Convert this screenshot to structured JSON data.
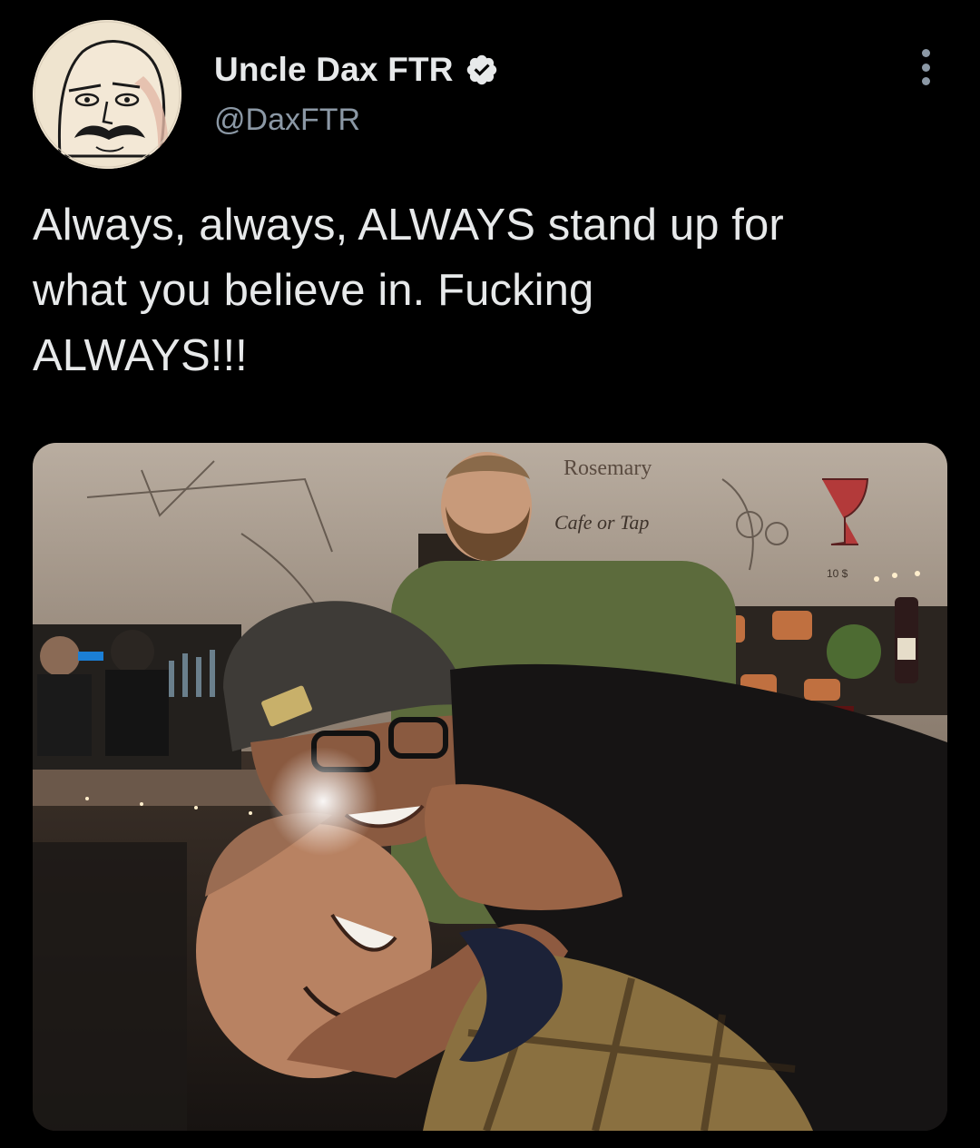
{
  "author": {
    "display_name": "Uncle Dax FTR",
    "handle": "@DaxFTR",
    "verified": true,
    "avatar_icon": "cartoon-bald-mustache-avatar",
    "verified_icon": "verified-badge-icon"
  },
  "tweet": {
    "text": "Always, always, ALWAYS stand up for\nwhat you believe in. Fucking\nALWAYS!!!"
  },
  "photo": {
    "wall_sign_text": "Rosemary",
    "wall_script_text": "Cafe or Tap",
    "price_tag": "10 $"
  },
  "colors": {
    "background": "#000000",
    "text_primary": "#e7e9ea",
    "text_secondary": "#8b98a5"
  },
  "icons": {
    "more": "more-options-icon"
  }
}
